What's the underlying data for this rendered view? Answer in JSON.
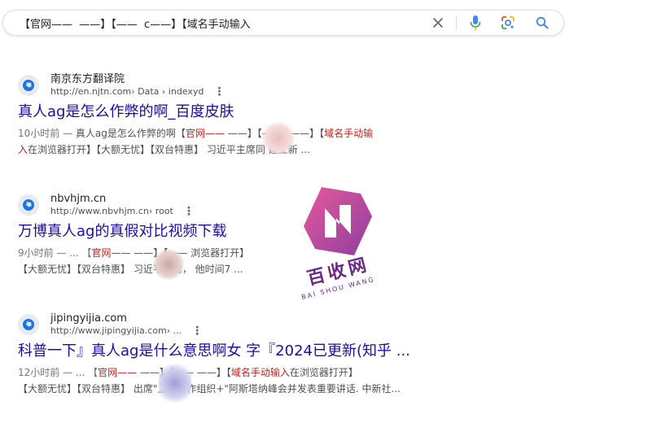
{
  "search": {
    "query": "【官网——  ——】【——  c——】【域名手动输入"
  },
  "results": [
    {
      "site_name": "南京东方翻译院",
      "url": "http://en.njtn.com",
      "url_path": " › Data › indexyd",
      "title": "真人ag是怎么作弊的啊_百度皮肤",
      "line1": [
        {
          "t": "10小时前 — ",
          "c": "time"
        },
        {
          "t": "真人ag是怎么作弊的啊【",
          "c": ""
        },
        {
          "t": "官网——",
          "c": "hl"
        },
        {
          "t": "  ——】【——  c——】【",
          "c": ""
        },
        {
          "t": "域名手动输",
          "c": "hl"
        }
      ],
      "line2": [
        {
          "t": "入",
          "c": "hl"
        },
        {
          "t": "在浏览器打开】【大额无忧】【双台特惠】 习近平主席同  建立新 ...",
          "c": ""
        }
      ]
    },
    {
      "site_name": "nbvhjm.cn",
      "url": "http://www.nbvhjm.cn",
      "url_path": " › root",
      "title": "万博真人ag的真假对比视频下载",
      "line1": [
        {
          "t": "9小时前 — ... 【",
          "c": "time"
        },
        {
          "t": "官网——",
          "c": "hl"
        },
        {
          "t": "  ——】【——  浏览器打开】",
          "c": ""
        }
      ],
      "line2": [
        {
          "t": "【大额无忧】【双台特惠】 习近平主席，  他时间7 ...",
          "c": ""
        }
      ]
    },
    {
      "site_name": "jipingyijia.com",
      "url": "http://www.jipingyijia.com",
      "url_path": " › ...",
      "title": "科普一下』真人ag是什么意思啊女  字『2024已更新(知乎 ...",
      "line1": [
        {
          "t": "12小时前 — ... 【",
          "c": "time"
        },
        {
          "t": "官网——",
          "c": "hl"
        },
        {
          "t": "  ——】【——  ——】【",
          "c": ""
        },
        {
          "t": "域名手动输入",
          "c": "hl"
        },
        {
          "t": "在浏览器打开】",
          "c": ""
        }
      ],
      "line2": [
        {
          "t": "【大额无忧】【双台特惠】  出席\"上海合作组织+\"阿斯塔纳峰会并发表重要讲话. 中新社...",
          "c": ""
        }
      ]
    }
  ],
  "watermark": {
    "cn": "百收网",
    "en": "BAI SHOU WANG"
  },
  "colors": {
    "title_link": "#1a0dab",
    "highlight": "#c5221f",
    "mic_blue": "#4285f4",
    "search_blue": "#4285f4",
    "watermark": "#6a2a86"
  },
  "icons": [
    "clear-icon",
    "mic-icon",
    "lens-icon",
    "search-icon",
    "globe-icon",
    "more-vert-icon"
  ]
}
